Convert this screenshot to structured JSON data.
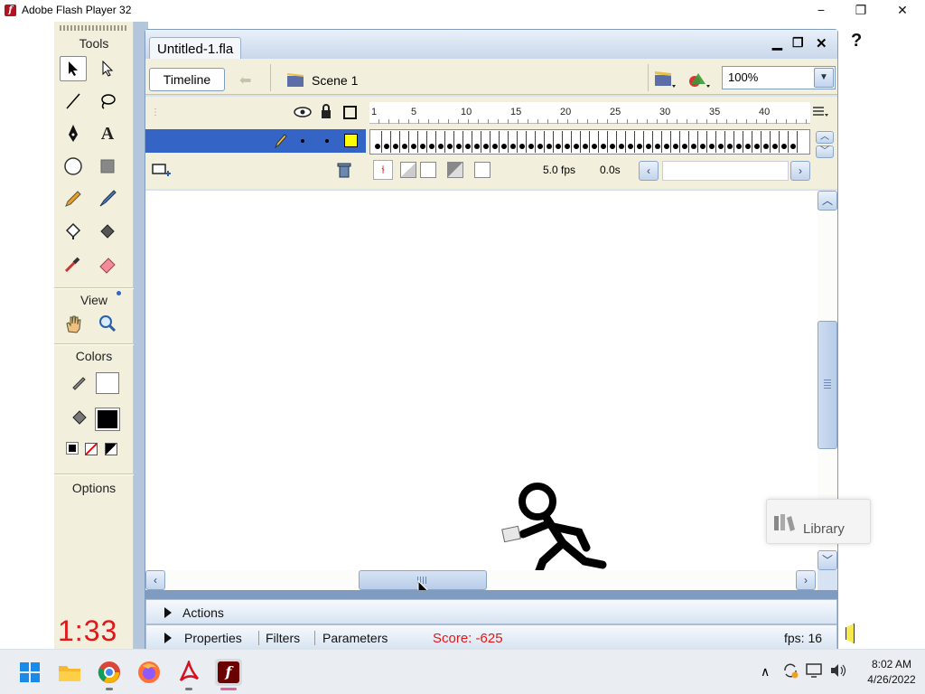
{
  "window": {
    "title": "Adobe Flash Player 32",
    "minimize": "−",
    "restore": "❐",
    "close": "✕"
  },
  "toolbox": {
    "tools_label": "Tools",
    "view_label": "View",
    "colors_label": "Colors",
    "options_label": "Options"
  },
  "timer": "1:33",
  "document": {
    "tab_title": "Untitled-1.fla",
    "timeline_button": "Timeline",
    "scene_label": "Scene 1",
    "zoom_value": "100%",
    "fps_text": "5.0 fps",
    "time_text": "0.0s",
    "ruler_ticks": [
      "1",
      "5",
      "10",
      "15",
      "20",
      "25",
      "30",
      "35",
      "40"
    ],
    "frame_count": 47
  },
  "panels": {
    "actions": "Actions",
    "properties_tabs": [
      "Properties",
      "Filters",
      "Parameters"
    ],
    "score": "Score: -625",
    "fps": "fps: 16"
  },
  "library": {
    "label": "Library"
  },
  "help_label": "?",
  "taskbar": {
    "icons": [
      "windows-start-icon",
      "file-explorer-icon",
      "chrome-icon",
      "firefox-icon",
      "adobe-acrobat-icon",
      "adobe-flash-icon"
    ],
    "clock_time": "8:02 AM",
    "clock_date": "4/26/2022",
    "tray_expand": "∧"
  },
  "colors": {
    "accent": "#3465c6",
    "timer": "#e01818",
    "score": "#e01818",
    "flash_red": "#b3121e"
  }
}
